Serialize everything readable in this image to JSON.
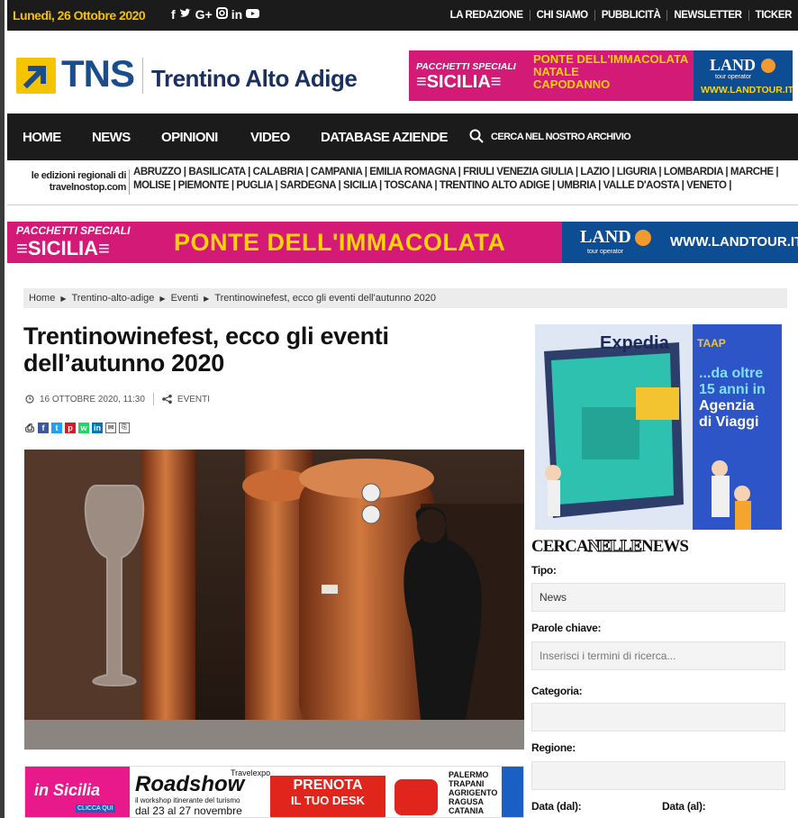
{
  "topbar": {
    "date": "Lunedì, 26 Ottobre 2020",
    "social": [
      "f",
      "🐦",
      "G+",
      "◎",
      "in",
      "▶"
    ],
    "links": [
      "LA REDAZIONE",
      "CHI SIAMO",
      "PUBBLICITÀ",
      "NEWSLETTER",
      "TICKER"
    ]
  },
  "header": {
    "logo_text": "TNS",
    "region_name": "Trentino Alto Adige"
  },
  "banner_small": {
    "pacchetti": "PACCHETTI SPECIALI",
    "sicilia": "≡SICILIA≡",
    "ponte_lines": [
      "PONTE DELL'IMMACOLATA",
      "NATALE",
      "CAPODANNO"
    ],
    "land": "LAND",
    "tour_operator": "tour operator",
    "url": "WWW.LANDTOUR.IT"
  },
  "nav": {
    "items": [
      "HOME",
      "NEWS",
      "OPINIONI",
      "VIDEO",
      "DATABASE AZIENDE"
    ],
    "search_label": "CERCA NEL NOSTRO ARCHIVIO"
  },
  "regions": {
    "editions_label": "le edizioni regionali di travelnostop.com",
    "list": "ABRUZZO | BASILICATA | CALABRIA | CAMPANIA | EMILIA ROMAGNA | FRIULI VENEZIA GIULIA | LAZIO | LIGURIA | LOMBARDIA | MARCHE | MOLISE | PIEMONTE | PUGLIA | SARDEGNA | SICILIA | TOSCANA | TRENTINO ALTO ADIGE | UMBRIA | VALLE D'AOSTA | VENETO |"
  },
  "banner_wide": {
    "pacchetti": "PACCHETTI SPECIALI",
    "sicilia": "≡SICILIA≡",
    "ponte": "PONTE DELL'IMMACOLATA",
    "land": "LAND",
    "tour_operator": "tour operator",
    "url": "WWW.LANDTOUR.IT"
  },
  "breadcrumb": [
    "Home",
    "Trentino-alto-adige",
    "Eventi",
    "Trentinowinefest, ecco gli eventi dell'autunno 2020"
  ],
  "article": {
    "title": "Trentinowinefest, ecco gli eventi dell’autunno 2020",
    "date": "16 OTTOBRE 2020, 11:30",
    "category": "EVENTI"
  },
  "share_icons": [
    "print-icon",
    "facebook-icon",
    "twitter-icon",
    "pinterest-icon",
    "whatsapp-icon",
    "linkedin-icon",
    "email-icon",
    "pdf-icon"
  ],
  "ad_bottom": {
    "in_sicilia": "in Sicilia",
    "clicca": "CLICCA QUI",
    "roadshow": "Roadshow",
    "travelexpo": "Travelexpo",
    "subtitle": "il workshop itinerante del turismo",
    "dates": "dal 23 al 27 novembre",
    "prenota": "PRENOTA",
    "desk": "IL TUO DESK",
    "cities": [
      "PALERMO",
      "TRAPANI",
      "AGRIGENTO",
      "RAGUSA",
      "CATANIA"
    ]
  },
  "side_ad": {
    "brand": "Expedia",
    "taap": "TAAP",
    "claim": [
      "...da oltre",
      "15 anni in",
      "Agenzia",
      "di Viaggi"
    ]
  },
  "search_box": {
    "title_a": "CERCA",
    "title_b": "NELLE",
    "title_c": "NEWS",
    "tipo_label": "Tipo:",
    "tipo_value": "News",
    "parole_label": "Parole chiave:",
    "parole_placeholder": "Inserisci i termini di ricerca...",
    "categoria_label": "Categoria:",
    "regione_label": "Regione:",
    "data_dal_label": "Data (dal):",
    "data_al_label": "Data (al):"
  }
}
